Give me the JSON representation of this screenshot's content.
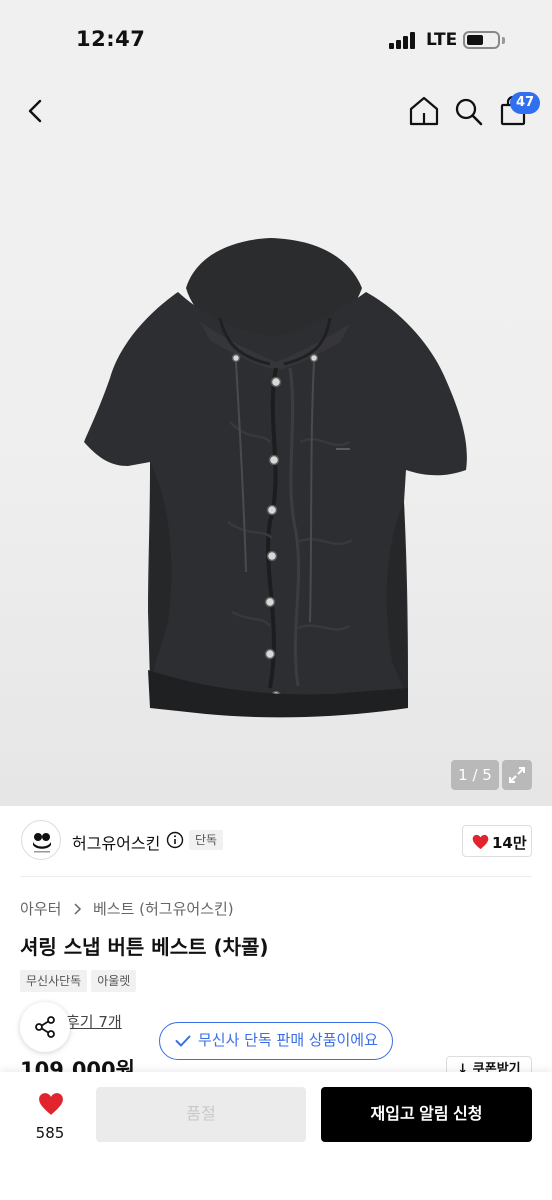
{
  "status_bar": {
    "time": "12:47",
    "network": "LTE"
  },
  "header": {
    "back_icon": "chevron-left-icon",
    "home_icon": "home-icon",
    "search_icon": "search-icon",
    "cart_icon": "shopping-bag-icon",
    "cart_count": "47"
  },
  "gallery": {
    "counter": "1 / 5",
    "expand_icon": "expand-icon"
  },
  "brand": {
    "name": "허그유어스킨",
    "exclusive_label": "단독",
    "like_count": "14만"
  },
  "product": {
    "breadcrumb": [
      "아우터",
      "베스트 (허그유어스킨)"
    ],
    "title": "셔링 스냅 버튼 베스트 (차콜)",
    "tags": [
      "무신사단독",
      "아울렛"
    ],
    "review_text": "후기 7개",
    "price": "109,000원",
    "coupon_label": "↓ 쿠폰받기"
  },
  "toast": {
    "text": "무신사 단독 판매 상품이에요"
  },
  "bottom_bar": {
    "wish_count": "585",
    "soldout_label": "품절",
    "restock_label": "재입고 알림 신청"
  },
  "colors": {
    "accent_blue": "#2f6ff0",
    "heart_red": "#e0252f",
    "primary_black": "#000000",
    "garment": "#2b2c2e"
  }
}
